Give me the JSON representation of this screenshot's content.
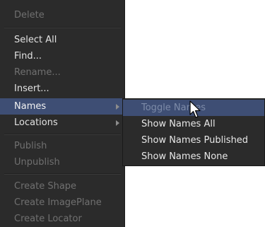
{
  "menu": {
    "items": [
      {
        "label": "Delete",
        "state": "disabled"
      },
      {
        "label": "Select All",
        "state": "enabled"
      },
      {
        "label": "Find...",
        "state": "enabled"
      },
      {
        "label": "Rename...",
        "state": "disabled"
      },
      {
        "label": "Insert...",
        "state": "enabled"
      },
      {
        "label": "Names",
        "state": "highlighted",
        "has_submenu": true
      },
      {
        "label": "Locations",
        "state": "enabled",
        "has_submenu": true
      },
      {
        "label": "Publish",
        "state": "disabled"
      },
      {
        "label": "Unpublish",
        "state": "disabled"
      },
      {
        "label": "Create Shape",
        "state": "disabled"
      },
      {
        "label": "Create ImagePlane",
        "state": "disabled"
      },
      {
        "label": "Create Locator",
        "state": "disabled"
      }
    ]
  },
  "submenu": {
    "items": [
      {
        "label": "Toggle Names",
        "state": "highlighted"
      },
      {
        "label": "Show Names All",
        "state": "enabled"
      },
      {
        "label": "Show Names Published",
        "state": "enabled"
      },
      {
        "label": "Show Names None",
        "state": "enabled"
      }
    ]
  },
  "colors": {
    "menu_background": "#2b2b2b",
    "highlight": "#3e4e74",
    "text": "#e2e2e2",
    "disabled_text": "#707070"
  },
  "icons": {
    "submenu_arrow": "chevron-right-icon",
    "cursor": "mouse-pointer-icon"
  }
}
